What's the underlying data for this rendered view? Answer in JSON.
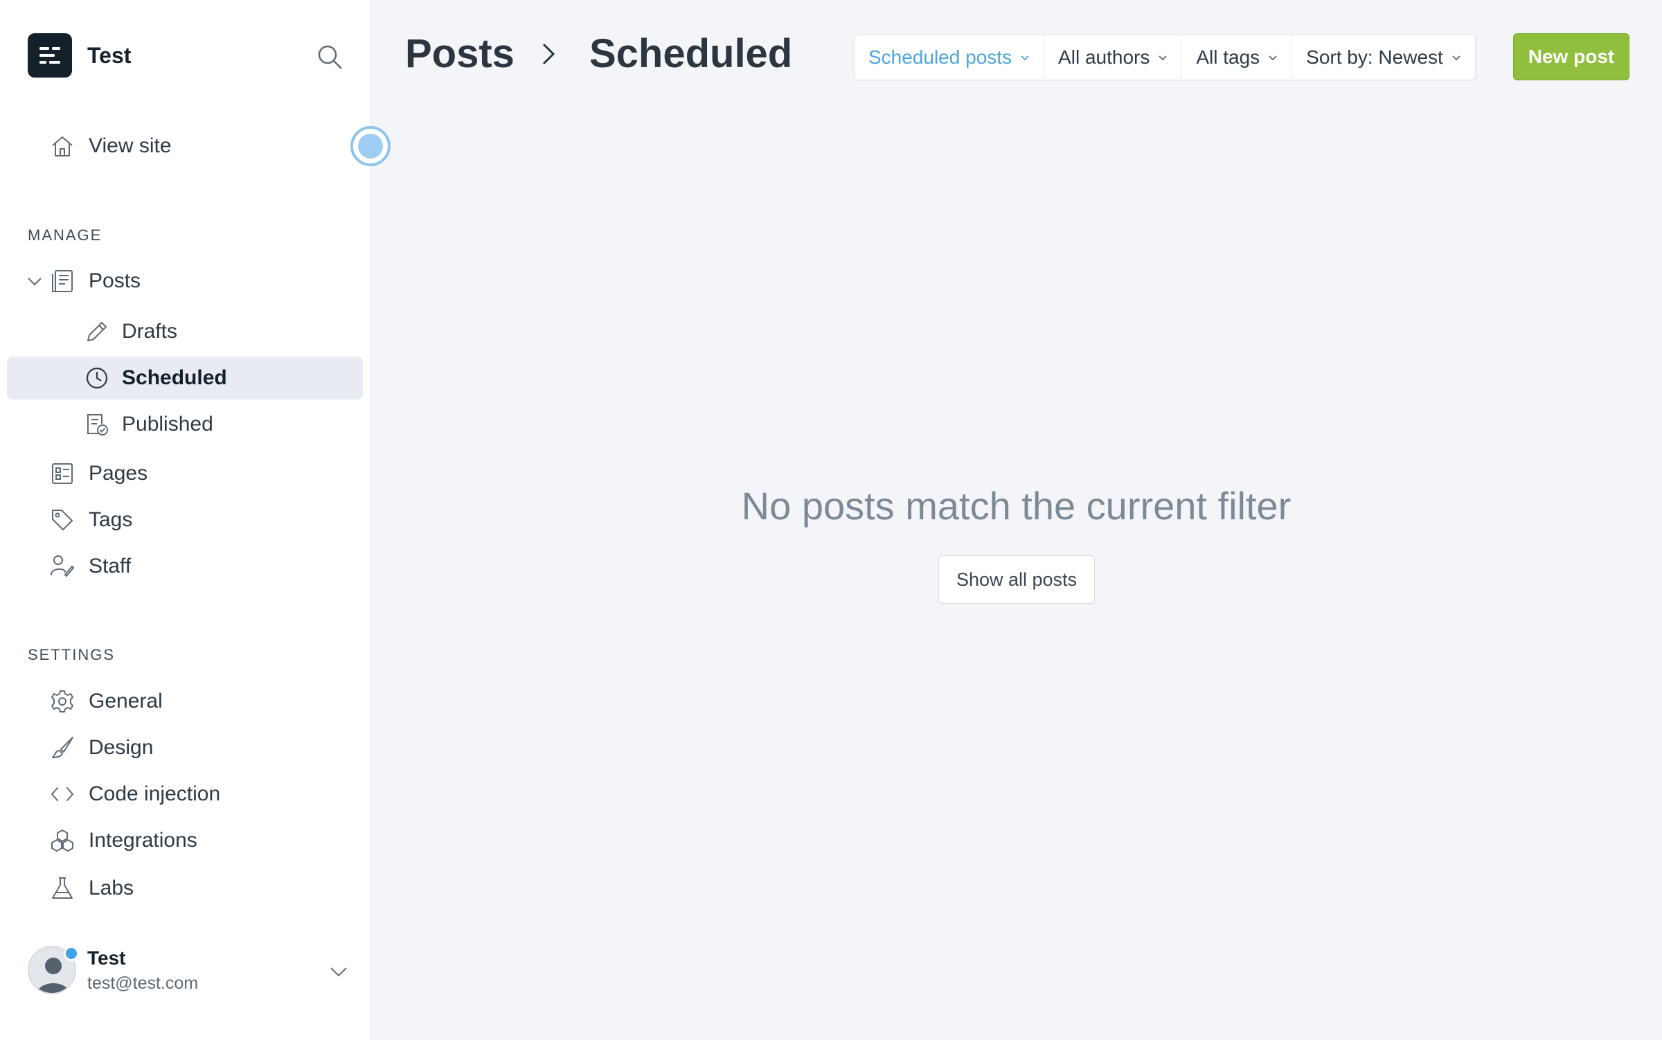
{
  "brand": {
    "name": "Test"
  },
  "nav": {
    "view_site": "View site",
    "manage_title": "MANAGE",
    "posts": "Posts",
    "drafts": "Drafts",
    "scheduled": "Scheduled",
    "published": "Published",
    "pages": "Pages",
    "tags": "Tags",
    "staff": "Staff",
    "settings_title": "SETTINGS",
    "general": "General",
    "design": "Design",
    "code_injection": "Code injection",
    "integrations": "Integrations",
    "labs": "Labs"
  },
  "user": {
    "name": "Test",
    "email": "test@test.com"
  },
  "header": {
    "breadcrumb_parent": "Posts",
    "breadcrumb_current": "Scheduled",
    "filters": {
      "type": "Scheduled posts",
      "authors": "All authors",
      "tags": "All tags",
      "sort": "Sort by: Newest"
    },
    "new_post": "New post"
  },
  "empty_state": {
    "message": "No posts match the current filter",
    "button": "Show all posts"
  },
  "colors": {
    "accent": "#8fbf3c",
    "active_filter": "#4da6e0",
    "sidebar_active_bg": "#e8ebf1",
    "brand_logo_bg": "#15212a"
  }
}
